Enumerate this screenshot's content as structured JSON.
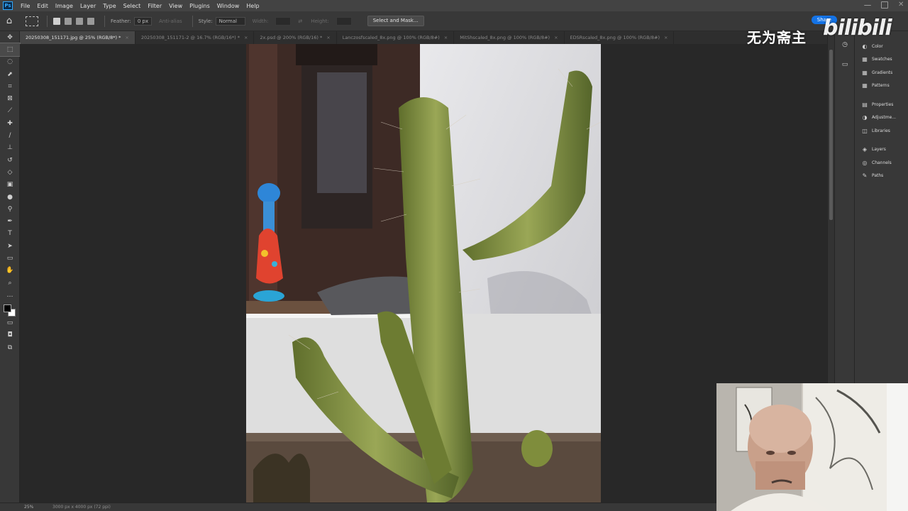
{
  "app": {
    "logo": "Ps",
    "menu": [
      "File",
      "Edit",
      "Image",
      "Layer",
      "Type",
      "Select",
      "Filter",
      "View",
      "Plugins",
      "Window",
      "Help"
    ]
  },
  "options": {
    "feather_label": "Feather:",
    "feather_value": "0 px",
    "antialias_label": "Anti-alias",
    "style_label": "Style:",
    "style_value": "Normal",
    "width_label": "Width:",
    "height_label": "Height:",
    "select_mask_label": "Select and Mask...",
    "share_label": "Share"
  },
  "tabs": [
    {
      "label": "20250308_151171.jpg @ 25% (RGB/8*) *",
      "close": "×"
    },
    {
      "label": "20250308_151171-2 @ 16.7% (RGB/16*) *",
      "close": "×"
    },
    {
      "label": "2x.psd @ 200% (RGB/16) *",
      "close": "×"
    },
    {
      "label": "Lanczosfscaled_8x.png @ 100% (RGB/8#)",
      "close": "×"
    },
    {
      "label": "MitShscaled_8x.png @ 100% (RGB/8#)",
      "close": "×"
    },
    {
      "label": "EDSRscaled_8x.png @ 100% (RGB/8#)",
      "close": "×"
    }
  ],
  "panels": [
    {
      "label": "Color",
      "icon": "color-wheel-icon",
      "glyph": "◐"
    },
    {
      "label": "Swatches",
      "icon": "swatches-grid-icon",
      "glyph": "▦"
    },
    {
      "label": "Gradients",
      "icon": "gradients-grid-icon",
      "glyph": "▦"
    },
    {
      "label": "Patterns",
      "icon": "patterns-grid-icon",
      "glyph": "▦"
    },
    {
      "label": "Properties",
      "icon": "properties-icon",
      "glyph": "▤"
    },
    {
      "label": "Adjustme...",
      "icon": "adjustments-icon",
      "glyph": "◑"
    },
    {
      "label": "Libraries",
      "icon": "libraries-icon",
      "glyph": "◫"
    },
    {
      "label": "Layers",
      "icon": "layers-icon",
      "glyph": "◈"
    },
    {
      "label": "Channels",
      "icon": "channels-icon",
      "glyph": "◎"
    },
    {
      "label": "Paths",
      "icon": "paths-icon",
      "glyph": "✎"
    }
  ],
  "status": {
    "zoom": "25%",
    "doc_info": "3000 px x 4000 px (72 ppi)"
  },
  "watermark": {
    "text_cn": "无为斋主",
    "logo": "bilibili"
  },
  "colors": {
    "accent": "#1473e6",
    "foreground": "#000000",
    "background": "#ffffff"
  }
}
